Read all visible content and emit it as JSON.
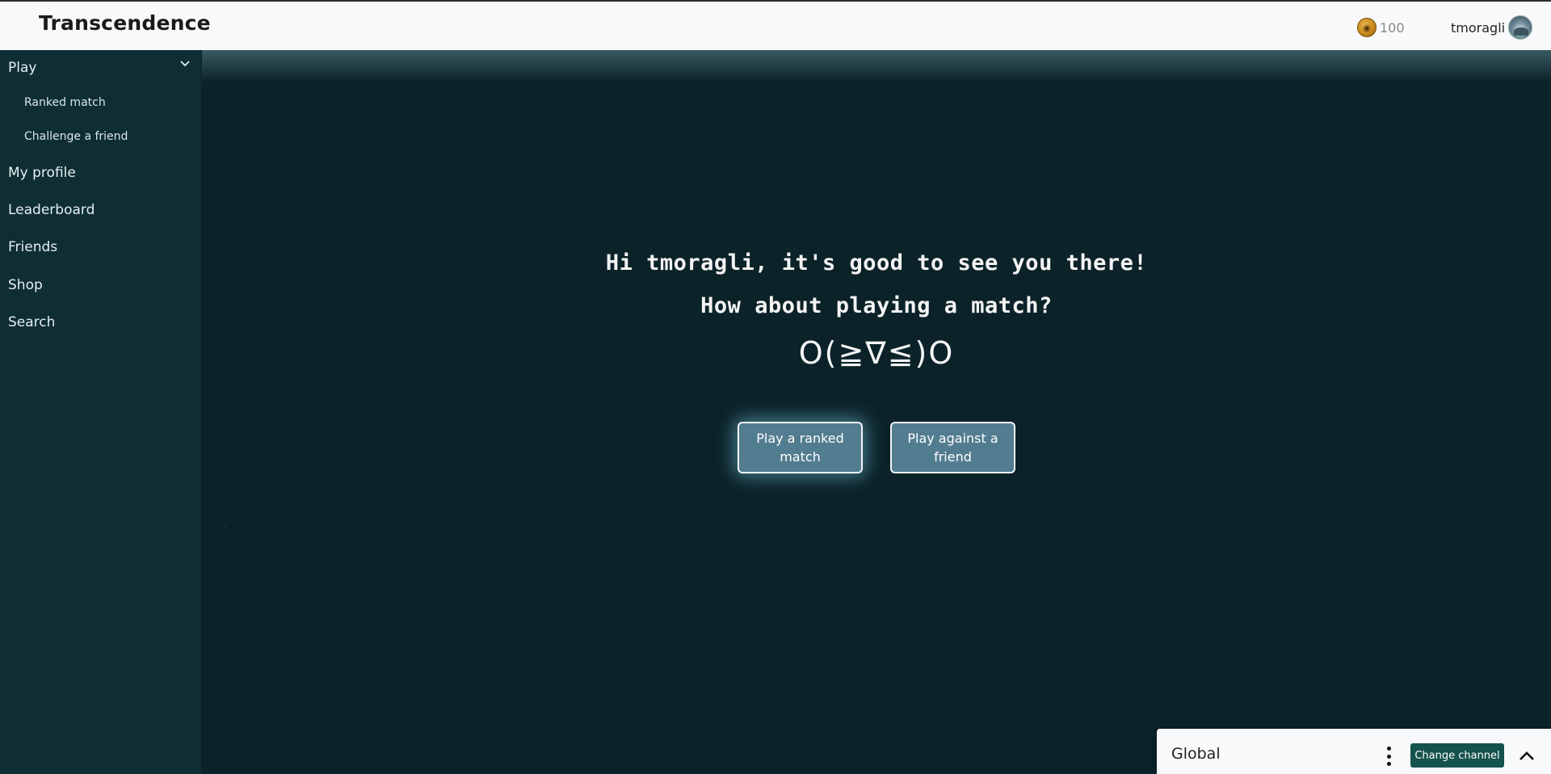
{
  "header": {
    "brand": "Transcendence",
    "coins": "100",
    "coin_icon": "coin-icon",
    "username": "tmoragli",
    "avatar_icon": "avatar-icon"
  },
  "sidebar": {
    "play": "Play",
    "play_sub": [
      "Ranked match",
      "Challenge a friend"
    ],
    "items": [
      "My profile",
      "Leaderboard",
      "Friends",
      "Shop",
      "Search"
    ]
  },
  "main": {
    "greeting": "Hi tmoragli, it's good to see you there!",
    "question": "How about playing a match?",
    "kaomoji": "O(≧∇≦)O",
    "ranked_button": "Play a ranked match",
    "friend_button": "Play against a friend"
  },
  "chat": {
    "title": "Global",
    "change_channel": "Change channel"
  },
  "colors": {
    "background": "#0b2228",
    "sidebar": "#0e2e34",
    "button": "#527c90",
    "accent": "#14524d"
  }
}
